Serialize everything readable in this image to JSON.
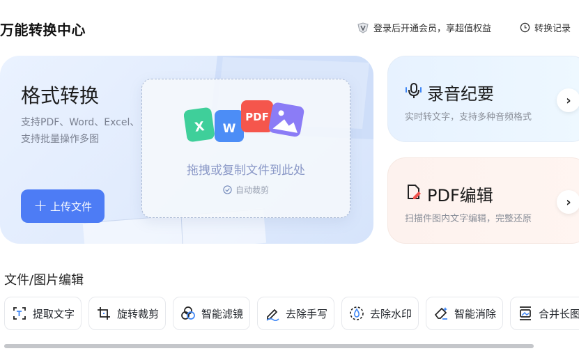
{
  "header": {
    "title": "万能转换中心",
    "vip_text": "登录后开通会员，享超值权益",
    "vip_icon": "vip-badge-icon",
    "history_text": "转换记录",
    "history_icon": "clock-icon"
  },
  "format_card": {
    "title": "格式转换",
    "desc_line1": "支持PDF、Word、Excel、",
    "desc_line2": "支持批量操作多图",
    "upload_label": "上传文件",
    "drop_text": "拖拽或复制文件到此处",
    "auto_crop": "自动裁剪",
    "doc_badges": {
      "excel": "X",
      "word": "W",
      "pdf": "PDF"
    }
  },
  "audio_card": {
    "title": "录音纪要",
    "desc": "实时转文字，支持多种音频格式",
    "icon": "microphone-icon"
  },
  "pdf_card": {
    "title": "PDF编辑",
    "desc": "扫描件图内文字编辑，完整还原",
    "icon": "pdf-edit-icon"
  },
  "section": {
    "title": "文件/图片编辑"
  },
  "tools": [
    {
      "label": "提取文字",
      "icon": "text-extract-icon"
    },
    {
      "label": "旋转裁剪",
      "icon": "crop-rotate-icon"
    },
    {
      "label": "智能滤镜",
      "icon": "filter-icon"
    },
    {
      "label": "去除手写",
      "icon": "erase-handwriting-icon"
    },
    {
      "label": "去除水印",
      "icon": "remove-watermark-icon"
    },
    {
      "label": "智能消除",
      "icon": "eraser-icon"
    },
    {
      "label": "合并长图",
      "icon": "merge-image-icon"
    }
  ],
  "colors": {
    "accent": "#4d7cf5",
    "excel": "#3fcf9a",
    "word": "#4c8df6",
    "pdf": "#f5564c",
    "image": "#8b7cf6"
  }
}
